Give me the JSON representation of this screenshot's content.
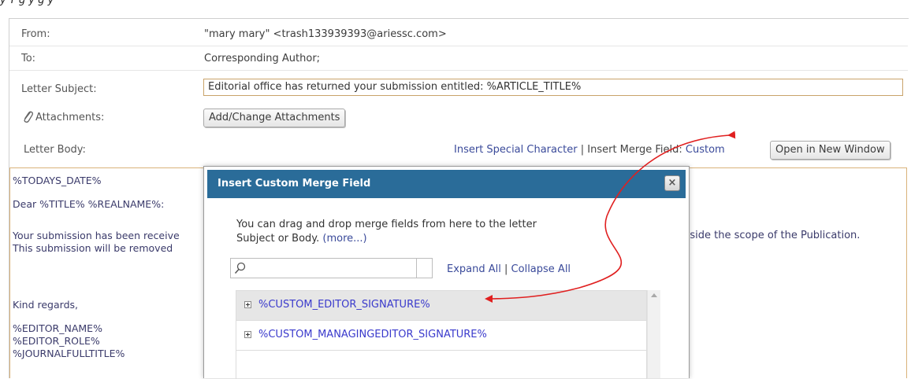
{
  "top_partial_text": "y            T                    g                                   y              g                                                                           y",
  "header": {
    "from_label": "From:",
    "from_value": "\"mary mary\" <trash133939393@ariessc.com>",
    "to_label": "To:",
    "to_value": "Corresponding Author;",
    "subject_label": "Letter Subject:",
    "subject_value": "Editorial office has returned your submission entitled: %ARTICLE_TITLE%",
    "attachments_label": "Attachments:",
    "attachments_button": "Add/Change Attachments",
    "body_label": "Letter Body:"
  },
  "toolbar": {
    "insert_special_character": "Insert Special Character",
    "separator": "|",
    "insert_merge_field_label": "Insert Merge Field:",
    "custom_link": "Custom",
    "open_new_window_button": "Open in New Window"
  },
  "letter_body": {
    "line1": "%TODAYS_DATE%",
    "line2": "Dear %TITLE% %REALNAME%:",
    "line3a": "Your submission has been receive",
    "line3b": "utside the scope of the Publication.",
    "line4": "This submission will be removed",
    "line5": "Kind regards,",
    "line6": "%EDITOR_NAME%",
    "line7": "%EDITOR_ROLE%",
    "line8": "%JOURNALFULLTITLE%"
  },
  "modal": {
    "title": "Insert Custom Merge Field",
    "close_icon": "close-icon",
    "description_line1": "You can drag and drop merge fields from here to the letter",
    "description_line2": "Subject or Body.",
    "more_link": "(more...)",
    "search_placeholder": "",
    "expand_all": "Expand All",
    "links_separator": "|",
    "collapse_all": "Collapse All",
    "items": [
      {
        "label": "%CUSTOM_EDITOR_SIGNATURE%",
        "selected": true
      },
      {
        "label": "%CUSTOM_MANAGINGEDITOR_SIGNATURE%",
        "selected": false
      }
    ]
  },
  "colors": {
    "modal_header": "#2a6c99",
    "link": "#3a4a9a",
    "merge_field_link": "#3a3acc",
    "annotation_arrow": "#e02020",
    "field_border": "#c9a36a"
  }
}
